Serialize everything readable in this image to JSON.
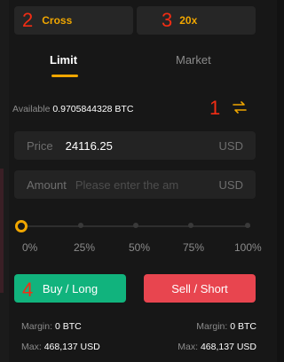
{
  "margin_mode": {
    "label": "Cross",
    "annotation": "2"
  },
  "leverage": {
    "label": "20x",
    "annotation": "3"
  },
  "tabs": [
    {
      "label": "Limit",
      "active": true
    },
    {
      "label": "Market",
      "active": false
    }
  ],
  "available": {
    "label": "Available",
    "value": "0.9705844328 BTC",
    "annotation": "1"
  },
  "price": {
    "label": "Price",
    "value": "24116.25",
    "unit": "USD"
  },
  "amount": {
    "label": "Amount",
    "placeholder": "Please enter the am",
    "unit": "USD"
  },
  "slider": {
    "value_percent": 0,
    "marks": [
      "0%",
      "25%",
      "50%",
      "75%",
      "100%"
    ]
  },
  "buttons": {
    "buy": "Buy / Long",
    "sell": "Sell / Short",
    "buy_annotation": "4"
  },
  "buy_info": {
    "margin_label": "Margin:",
    "margin_value": "0 BTC",
    "max_label": "Max:",
    "max_value": "468,137 USD"
  },
  "sell_info": {
    "margin_label": "Margin:",
    "margin_value": "0 BTC",
    "max_label": "Max:",
    "max_value": "468,137 USD"
  },
  "colors": {
    "accent": "#f0a600",
    "buy": "#11b37d",
    "sell": "#e8454f",
    "annotation": "#f32d14"
  }
}
